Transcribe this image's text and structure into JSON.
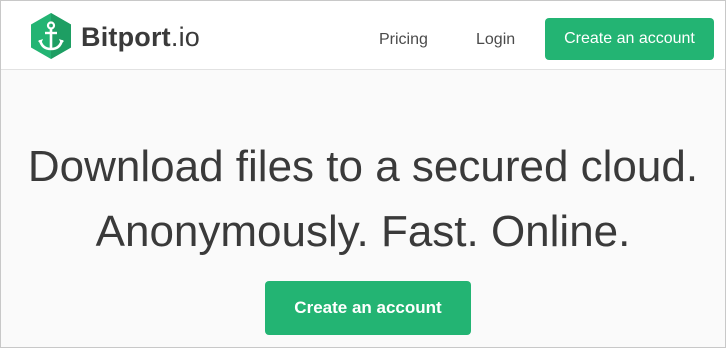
{
  "header": {
    "brand": {
      "name_bold": "Bitport",
      "name_suffix": ".io",
      "logo_icon": "anchor-icon"
    },
    "nav": {
      "pricing": "Pricing",
      "login": "Login"
    },
    "cta": "Create an account"
  },
  "hero": {
    "headline_line1": "Download files to a secured cloud.",
    "headline_line2": "Anonymously. Fast. Online.",
    "cta": "Create an account"
  },
  "colors": {
    "accent": "#23b473",
    "logo_dark": "#1e9e63",
    "text": "#3a3a3a"
  }
}
